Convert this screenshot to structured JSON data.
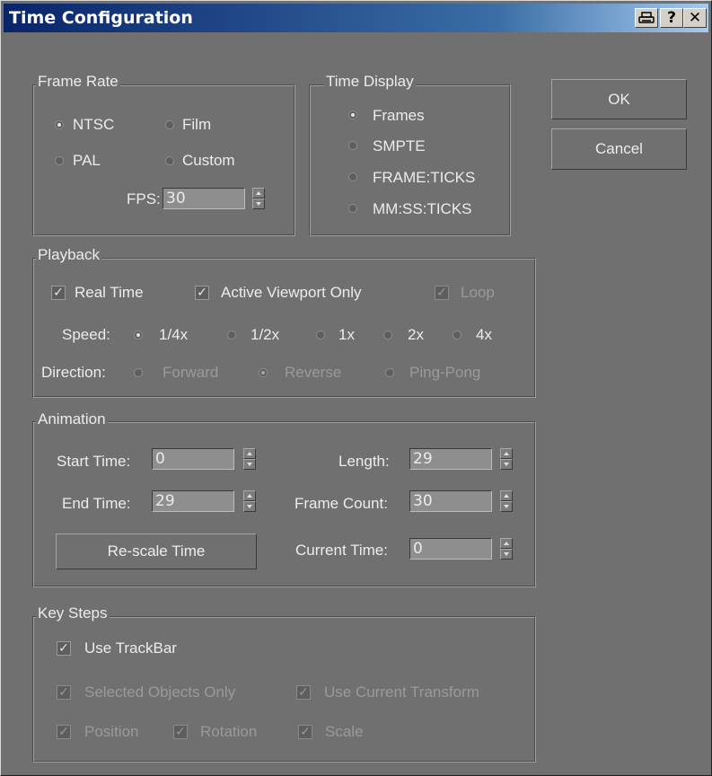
{
  "window": {
    "title": "Time Configuration",
    "title_buttons": [
      {
        "label": "⎙",
        "icon": "printer-icon"
      },
      {
        "label": "?",
        "icon": "help-icon"
      },
      {
        "label": "✕",
        "icon": "close-icon"
      }
    ]
  },
  "frame_rate": {
    "legend": "Frame Rate",
    "ntsc": "NTSC",
    "film": "Film",
    "pal": "PAL",
    "custom": "Custom",
    "selected": "NTSC",
    "fps_label": "FPS:",
    "fps_value": "30"
  },
  "time_display": {
    "legend": "Time Display",
    "frames": "Frames",
    "smpte": "SMPTE",
    "frame_ticks": "FRAME:TICKS",
    "mmss_ticks": "MM:SS:TICKS",
    "selected": "Frames"
  },
  "buttons": {
    "ok": "OK",
    "cancel": "Cancel"
  },
  "playback": {
    "legend": "Playback",
    "real_time": "Real Time",
    "active_viewport_only": "Active Viewport Only",
    "loop": "Loop",
    "speed_label": "Speed:",
    "speed_quarter": "1/4x",
    "speed_half": "1/2x",
    "speed_1x": "1x",
    "speed_2x": "2x",
    "speed_4x": "4x",
    "speed_selected": "1/4x",
    "direction_label": "Direction:",
    "forward": "Forward",
    "reverse": "Reverse",
    "ping_pong": "Ping-Pong",
    "direction_selected": "Reverse"
  },
  "animation": {
    "legend": "Animation",
    "start_time_label": "Start Time:",
    "start_time_value": "0",
    "end_time_label": "End Time:",
    "end_time_value": "29",
    "length_label": "Length:",
    "length_value": "29",
    "frame_count_label": "Frame Count:",
    "frame_count_value": "30",
    "current_time_label": "Current Time:",
    "current_time_value": "0",
    "rescale_button": "Re-scale Time"
  },
  "key_steps": {
    "legend": "Key Steps",
    "use_trackbar": "Use TrackBar",
    "selected_objects_only": "Selected Objects Only",
    "use_current_transform": "Use Current Transform",
    "position": "Position",
    "rotation": "Rotation",
    "scale": "Scale"
  }
}
